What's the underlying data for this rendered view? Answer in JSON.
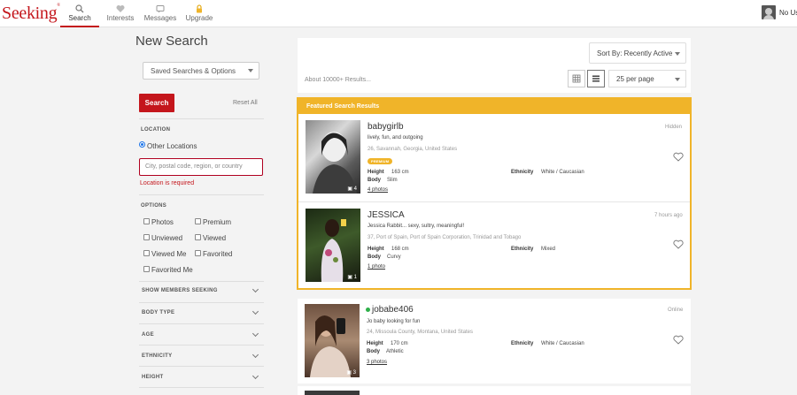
{
  "nav": {
    "logo": "Seeking",
    "logo_mark": "®",
    "items": [
      {
        "label": "Search",
        "icon": "search-icon"
      },
      {
        "label": "Interests",
        "icon": "heart-icon"
      },
      {
        "label": "Messages",
        "icon": "message-icon"
      },
      {
        "label": "Upgrade",
        "icon": "lock-icon"
      }
    ],
    "user_name": "No Us"
  },
  "sidebar": {
    "title": "New Search",
    "saved_searches": "Saved Searches & Options",
    "search_button": "Search",
    "reset_all": "Reset All",
    "location_label": "LOCATION",
    "other_locations": "Other Locations",
    "location_placeholder": "City, postal code, region, or country",
    "location_error": "Location is required",
    "options_label": "OPTIONS",
    "options": [
      "Photos",
      "Premium",
      "Unviewed",
      "Viewed",
      "Viewed Me",
      "Favorited",
      "Favorited Me"
    ],
    "accordions": [
      "SHOW MEMBERS SEEKING",
      "BODY TYPE",
      "AGE",
      "ETHNICITY",
      "HEIGHT"
    ]
  },
  "results": {
    "sort": "Sort By: Recently Active",
    "about": "About 10000+ Results...",
    "per_page": "25 per page",
    "featured_header": "Featured Search Results",
    "labels": {
      "height": "Height",
      "body": "Body",
      "ethnicity": "Ethnicity"
    },
    "cards": [
      {
        "username": "babygirlb",
        "tagline": "lively, fun, and outgoing",
        "location": "26, Savannah, Georgia, United States",
        "badge": "PREMIUM",
        "height": "163 cm",
        "body": "Slim",
        "ethnicity": "White / Caucasian",
        "photos": "4 photos",
        "photo_count": "4",
        "status": "Hidden"
      },
      {
        "username": "JESSICA",
        "tagline": "Jessica Rabbit... sexy, sultry, meaningful!",
        "location": "37, Port of Spain, Port of Spain Corporation, Trinidad and Tobago",
        "height": "168 cm",
        "body": "Curvy",
        "ethnicity": "Mixed",
        "photos": "1 photo",
        "photo_count": "1",
        "status": "7 hours ago"
      },
      {
        "username": "jobabe406",
        "tagline": "Jo baby looking for fun",
        "location": "24, Missoula County, Montana, United States",
        "height": "170 cm",
        "body": "Athletic",
        "ethnicity": "White / Caucasian",
        "photos": "3 photos",
        "photo_count": "3",
        "status": "Online",
        "online": true
      }
    ]
  },
  "colors": {
    "brand": "#c4161c",
    "featured": "#f0b429",
    "online": "#2eaf4a",
    "link": "#1a73e8"
  }
}
